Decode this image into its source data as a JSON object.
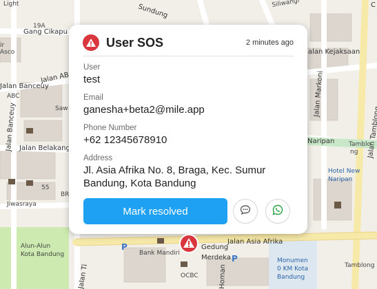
{
  "map": {
    "streets": [
      "Jalan Banceuy",
      "Jalan Belakang",
      "Jalan AB",
      "Jalan Asia Afrika",
      "Jalan Kejaksaan",
      "Jalan Markoni",
      "Jalan Tamblong",
      "Jiwasraya",
      "Gang Cikapu",
      "Jalan Ti",
      "Homan",
      "Sundung",
      "Siliwangi"
    ],
    "places": [
      "Bank Mandiri",
      "Gedung Merdeka",
      "OCBC",
      "Hotel New Naripan",
      "Monumen 0 KM Kota Bandung",
      "Alun-Alun Kota Bandung",
      "Naripan",
      "Tamblong",
      "Sawahan",
      "ABC",
      "Asco",
      "Light",
      "19A",
      "55",
      "BR",
      "Tamblon",
      "Tamblong"
    ]
  },
  "popup": {
    "title": "User SOS",
    "time": "2 minutes ago",
    "user_label": "User",
    "user_value": "test",
    "email_label": "Email",
    "email_value": "ganesha+beta2@mile.app",
    "phone_label": "Phone Number",
    "phone_value": "+62 12345678910",
    "address_label": "Address",
    "address_value": "Jl. Asia Afrika No. 8, Braga, Kec. Sumur Bandung, Kota Bandung",
    "resolve_label": "Mark resolved"
  },
  "colors": {
    "sos_red": "#d9363e",
    "resolve_blue": "#1ea1f2",
    "whatsapp_green": "#25a244"
  },
  "icons": {
    "sos": "warning-icon",
    "chat": "chat-bubble-icon",
    "whatsapp": "whatsapp-icon",
    "marker": "sos-marker-icon"
  }
}
